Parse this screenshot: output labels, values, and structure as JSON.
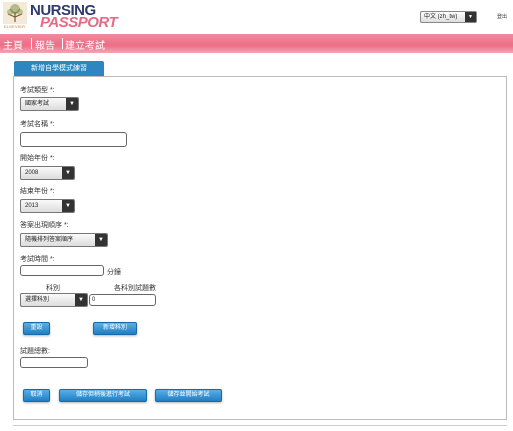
{
  "header": {
    "brand_top": "NURSING",
    "brand_bottom": "PASSPORT",
    "elsevier": "ELSEVIER",
    "language": "中文 (zh_tw)",
    "logout": "登出"
  },
  "nav": {
    "items": [
      "主頁",
      "報告",
      "建立考試"
    ]
  },
  "tab": {
    "label": "新增自學模式練習"
  },
  "form": {
    "exam_type_label": "考試類型 *:",
    "exam_type_value": "國家考試",
    "exam_name_label": "考試名稱 *:",
    "exam_name_value": "",
    "start_year_label": "開始年份 *:",
    "start_year_value": "2008",
    "end_year_label": "結束年份 *:",
    "end_year_value": "2013",
    "answer_order_label": "答案出現順序 *:",
    "answer_order_value": "隨機排列答案順序",
    "exam_time_label": "考試時間 *:",
    "exam_time_value": "",
    "minutes_unit": "分鐘",
    "subject_header": "科別",
    "questions_header": "各科別試題數",
    "subject_value": "選擇科別",
    "questions_value": "0",
    "reset_button": "重設",
    "add_subject_button": "新增科別",
    "total_questions_label": "試題總數:",
    "total_questions_value": "",
    "cancel_button": "取消",
    "save_later_button": "儲存但稍後進行考試",
    "save_start_button": "儲存並開始考試"
  },
  "colors": {
    "nav_pink": "#ec6e86",
    "tab_blue": "#2e86c1",
    "brand_navy": "#2f3a6e",
    "brand_pink": "#e66a86"
  }
}
